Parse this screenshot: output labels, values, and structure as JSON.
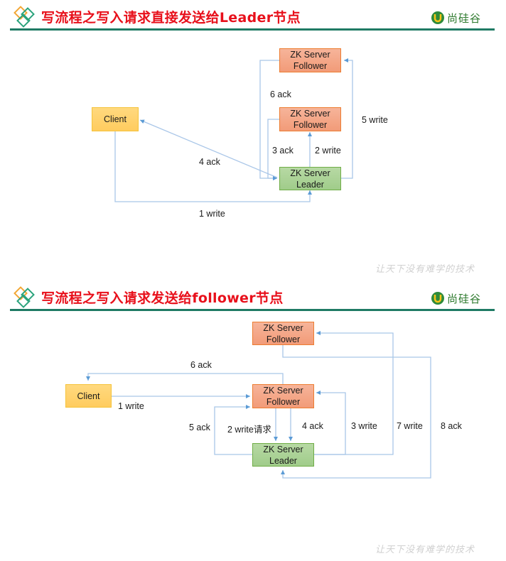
{
  "slides": [
    {
      "title": "写流程之写入请求直接发送给Leader节点",
      "brand": "尚硅谷",
      "watermark": "让天下没有难学的技术",
      "nodes": {
        "client": "Client",
        "follower_top": [
          "ZK Server",
          "Follower"
        ],
        "follower_mid": [
          "ZK Server",
          "Follower"
        ],
        "leader": [
          "ZK Server",
          "Leader"
        ]
      },
      "edges": [
        {
          "id": "1",
          "label": "1 write",
          "from": "Client",
          "to": "Leader"
        },
        {
          "id": "2",
          "label": "2 write",
          "from": "Leader",
          "to": "Follower (middle)"
        },
        {
          "id": "3",
          "label": "3 ack",
          "from": "Follower (middle)",
          "to": "Leader"
        },
        {
          "id": "4",
          "label": "4 ack",
          "from": "Leader",
          "to": "Client"
        },
        {
          "id": "5",
          "label": "5 write",
          "from": "Leader",
          "to": "Follower (top)"
        },
        {
          "id": "6",
          "label": "6 ack",
          "from": "Follower (top)",
          "to": "Leader"
        }
      ]
    },
    {
      "title": "写流程之写入请求发送给follower节点",
      "brand": "尚硅谷",
      "watermark": "让天下没有难学的技术",
      "nodes": {
        "client": "Client",
        "follower_top": [
          "ZK Server",
          "Follower"
        ],
        "follower_mid": [
          "ZK Server",
          "Follower"
        ],
        "leader": [
          "ZK Server",
          "Leader"
        ]
      },
      "edges": [
        {
          "id": "1",
          "label": "1 write",
          "from": "Client",
          "to": "Follower (middle)"
        },
        {
          "id": "2",
          "label": "2 write请求",
          "from": "Follower (middle)",
          "to": "Leader"
        },
        {
          "id": "3",
          "label": "3 write",
          "from": "Leader",
          "to": "Follower (middle)"
        },
        {
          "id": "4",
          "label": "4 ack",
          "from": "Follower (middle)",
          "to": "Leader"
        },
        {
          "id": "5",
          "label": "5 ack",
          "from": "Leader",
          "to": "Follower (middle)"
        },
        {
          "id": "6",
          "label": "6 ack",
          "from": "Follower (middle)",
          "to": "Client"
        },
        {
          "id": "7",
          "label": "7 write",
          "from": "Leader",
          "to": "Follower (top)"
        },
        {
          "id": "8",
          "label": "8 ack",
          "from": "Follower (top)",
          "to": "Leader"
        }
      ]
    }
  ],
  "colors": {
    "title": "#e8101b",
    "header_line": "#1f7a64",
    "follower_fill": "#f4a582",
    "follower_border": "#ed7d31",
    "leader_fill": "#a9d18e",
    "leader_border": "#70ad47",
    "client_fill": "#ffd966",
    "client_border": "#f5c33a",
    "connector": "#8db4e2",
    "arrow": "#5b9bd5"
  }
}
